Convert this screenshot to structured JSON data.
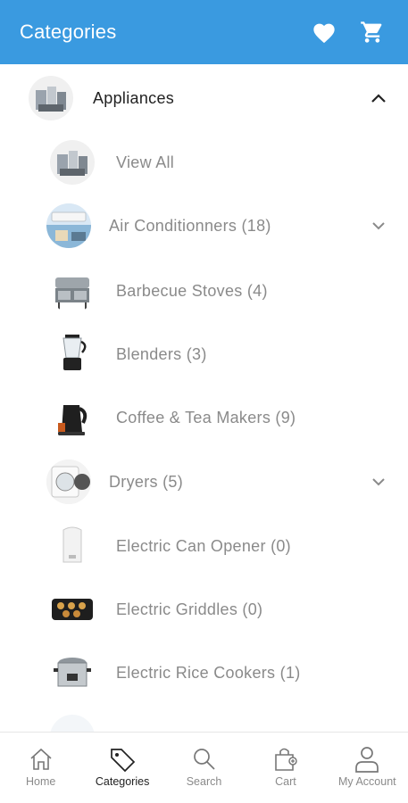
{
  "header": {
    "title": "Categories",
    "wishlist_icon": "heart-icon",
    "cart_icon": "cart-icon"
  },
  "colors": {
    "appbar": "#3a9ae0",
    "text_primary": "#222222",
    "text_secondary": "#8a8a8a"
  },
  "category": {
    "name": "Appliances",
    "expanded": true,
    "children": [
      {
        "label": "View All",
        "expandable": false
      },
      {
        "label": "Air Conditionners (18)",
        "expandable": true
      },
      {
        "label": "Barbecue Stoves (4)",
        "expandable": false
      },
      {
        "label": "Blenders (3)",
        "expandable": false
      },
      {
        "label": "Coffee & Tea Makers (9)",
        "expandable": false
      },
      {
        "label": "Dryers (5)",
        "expandable": true
      },
      {
        "label": "Electric Can Opener (0)",
        "expandable": false
      },
      {
        "label": "Electric Griddles (0)",
        "expandable": false
      },
      {
        "label": "Electric Rice Cookers (1)",
        "expandable": false
      }
    ]
  },
  "bottom_nav": [
    {
      "label": "Home",
      "icon": "home-icon",
      "active": false
    },
    {
      "label": "Categories",
      "icon": "tag-icon",
      "active": true
    },
    {
      "label": "Search",
      "icon": "search-icon",
      "active": false
    },
    {
      "label": "Cart",
      "icon": "cart-icon",
      "active": false
    },
    {
      "label": "My Account",
      "icon": "person-icon",
      "active": false
    }
  ]
}
